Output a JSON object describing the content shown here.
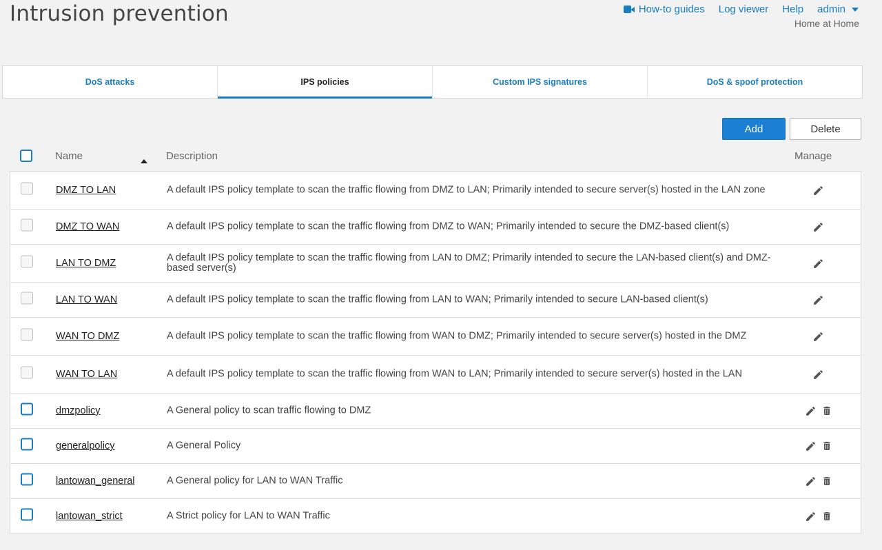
{
  "page": {
    "title": "Intrusion prevention"
  },
  "top_links": {
    "how_to": "How-to guides",
    "log_viewer": "Log viewer",
    "help": "Help",
    "admin": "admin",
    "location": "Home at Home"
  },
  "tabs": [
    {
      "label": "DoS attacks",
      "active": false
    },
    {
      "label": "IPS policies",
      "active": true
    },
    {
      "label": "Custom IPS signatures",
      "active": false
    },
    {
      "label": "DoS & spoof protection",
      "active": false
    }
  ],
  "buttons": {
    "add": "Add",
    "delete": "Delete"
  },
  "table": {
    "columns": {
      "name": "Name",
      "description": "Description",
      "manage": "Manage"
    },
    "rows": [
      {
        "name": "DMZ TO LAN",
        "description": "A default IPS policy template to scan the traffic flowing from DMZ to LAN; Primarily intended to secure server(s) hosted in the LAN zone",
        "default": true
      },
      {
        "name": "DMZ TO WAN",
        "description": "A default IPS policy template to scan the traffic flowing from DMZ to WAN; Primarily intended to secure the DMZ-based client(s)",
        "default": true
      },
      {
        "name": "LAN TO DMZ",
        "description": "A default IPS policy template to scan the traffic flowing from LAN to DMZ; Primarily intended to secure the LAN-based client(s) and DMZ-based server(s)",
        "default": true
      },
      {
        "name": "LAN TO WAN",
        "description": "A default IPS policy template to scan the traffic flowing from LAN to WAN; Primarily intended to secure LAN-based client(s)",
        "default": true
      },
      {
        "name": "WAN TO DMZ",
        "description": "A default IPS policy template to scan the traffic flowing from WAN to DMZ; Primarily intended to secure server(s) hosted in the DMZ",
        "default": true
      },
      {
        "name": "WAN TO LAN",
        "description": "A default IPS policy template to scan the traffic flowing from WAN to LAN; Primarily intended to secure server(s) hosted in the LAN",
        "default": true
      },
      {
        "name": "dmzpolicy",
        "description": "A General policy to scan traffic flowing to DMZ",
        "default": false
      },
      {
        "name": "generalpolicy",
        "description": "A General Policy",
        "default": false
      },
      {
        "name": "lantowan_general",
        "description": "A General policy for LAN to WAN Traffic",
        "default": false
      },
      {
        "name": "lantowan_strict",
        "description": "A Strict policy for LAN to WAN Traffic",
        "default": false
      }
    ]
  },
  "icons": {
    "edit": "pencil-icon",
    "delete": "trash-icon",
    "video": "video-camera-icon",
    "sort": "sort-ascending-icon"
  },
  "colors": {
    "accent": "#1a7dc1",
    "primary_button": "#1b80d4"
  }
}
